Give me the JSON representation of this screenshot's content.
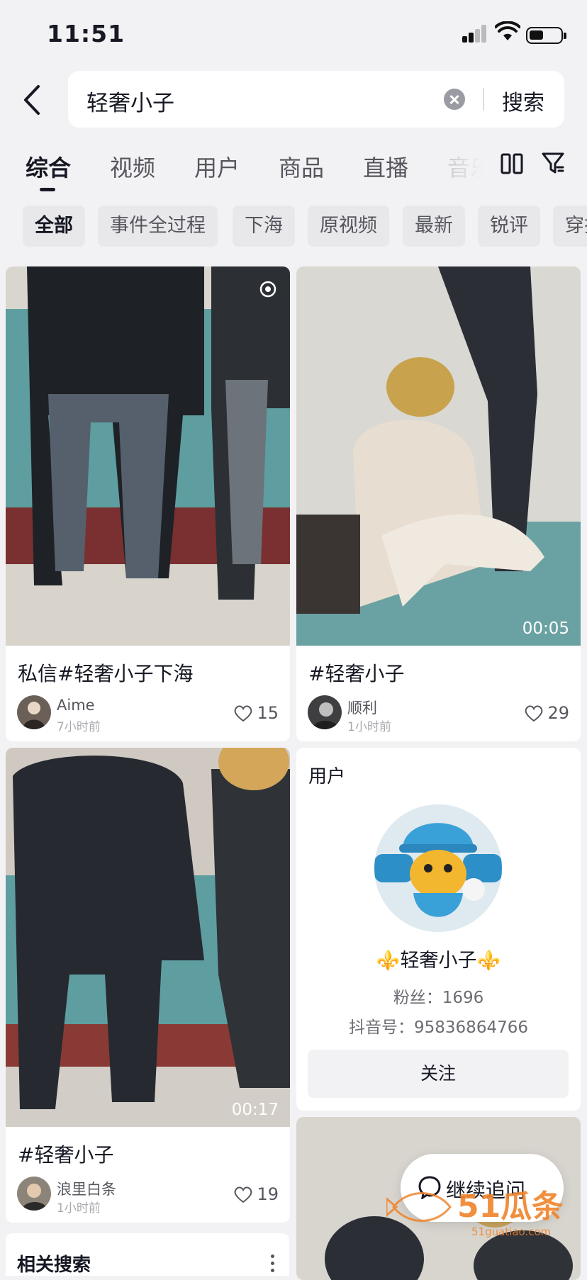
{
  "status_bar": {
    "time": "11:51"
  },
  "search": {
    "query": "轻奢小子",
    "button": "搜索"
  },
  "tabs": [
    {
      "label": "综合",
      "active": true
    },
    {
      "label": "视频"
    },
    {
      "label": "用户"
    },
    {
      "label": "商品"
    },
    {
      "label": "直播"
    },
    {
      "label": "音乐"
    }
  ],
  "chips": [
    {
      "label": "全部",
      "active": true
    },
    {
      "label": "事件全过程"
    },
    {
      "label": "下海"
    },
    {
      "label": "原视频"
    },
    {
      "label": "最新"
    },
    {
      "label": "锐评"
    },
    {
      "label": "穿搭"
    }
  ],
  "videos": [
    {
      "title": "私信#轻奢小子下海",
      "author": "Aime",
      "time": "7小时前",
      "likes": "15"
    },
    {
      "title": "#轻奢小子",
      "author": "顺利",
      "time": "1小时前",
      "likes": "29",
      "duration": "00:05"
    },
    {
      "title": "#轻奢小子",
      "author": "浪里白条",
      "time": "1小时前",
      "likes": "19",
      "duration": "00:17"
    }
  ],
  "user_card": {
    "header": "用户",
    "name": "⚜️轻奢小子⚜️",
    "fans": "粉丝：1696",
    "douyin_id": "抖音号：95836864766",
    "follow": "关注"
  },
  "related": {
    "title": "相关搜索"
  },
  "continue_button": {
    "label": "继续追问"
  },
  "watermark": {
    "text": "51瓜条",
    "url": "51guatiao.com"
  }
}
